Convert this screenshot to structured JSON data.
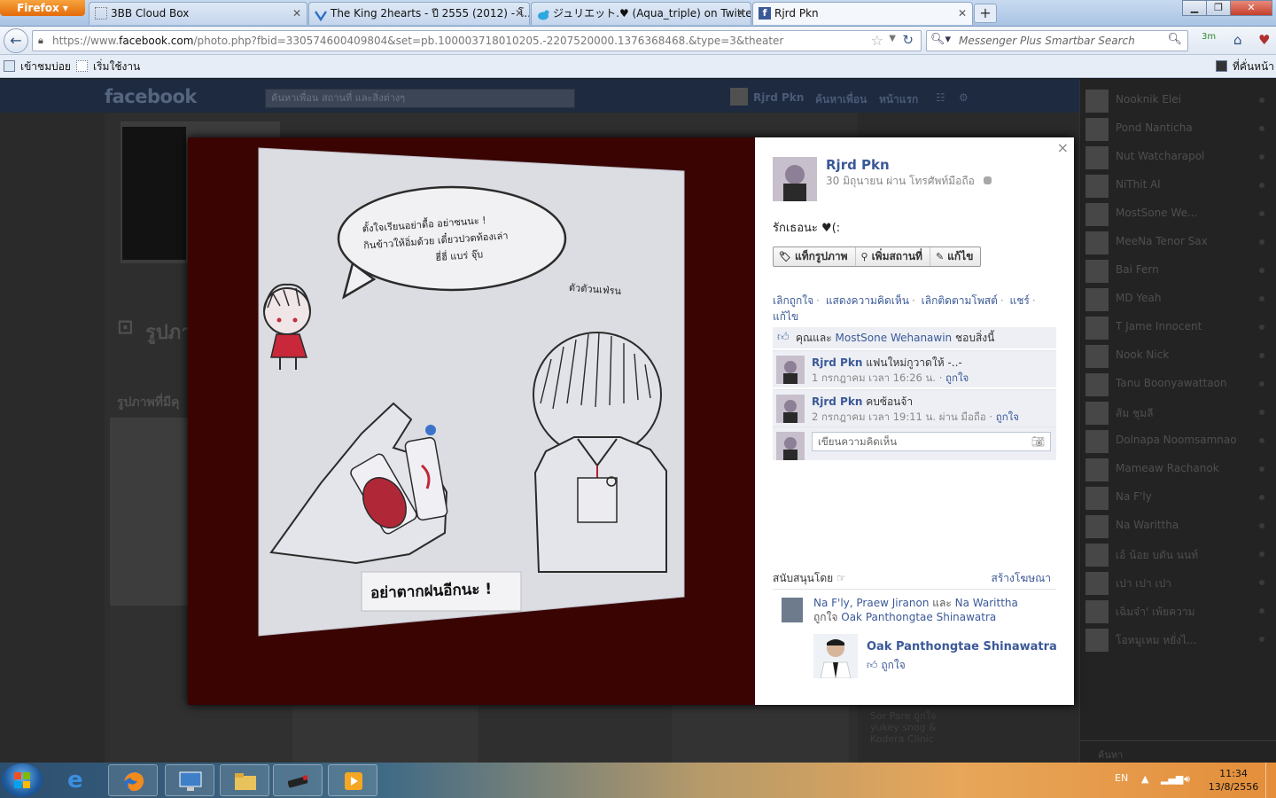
{
  "browser": {
    "app_button": "Firefox",
    "tabs": [
      {
        "title": "3BB Cloud Box",
        "active": false
      },
      {
        "title": "The King 2hearts - ปี 2555 (2012) - โ...",
        "active": false
      },
      {
        "title": "ジュリエット.♥ (Aqua_triple) on Twitter",
        "active": false
      },
      {
        "title": "Rjrd Pkn",
        "active": true
      }
    ],
    "url_prefix": "https://www.",
    "url_domain": "facebook.com",
    "url_rest": "/photo.php?fbid=330574600409804&set=pb.100003718010205.-2207520000.1376368468.&type=3&theater",
    "search_placeholder": "Messenger Plus Smartbar Search",
    "bookmarks": [
      "เข้าชมบ่อย",
      "เริ่มใช้งาน"
    ],
    "bookmarks_right": "ที่คั่นหน้า"
  },
  "facebook_bg": {
    "logo": "facebook",
    "search_placeholder": "ค้นหาเพื่อน สถานที่ และสิ่งต่างๆ",
    "nav": [
      "Rjrd Pkn",
      "ค้นหาเพื่อน",
      "หน้าแรก"
    ],
    "section_title": "รูปภา",
    "section_sub": "รูปภาพที่มีคุ",
    "ads_text": [
      "Sor Pare ถูกใจ",
      "yukey snog &",
      "Kodera Clinic"
    ],
    "chat_search": "ค้นหา",
    "chat_list": [
      "Nooknik Elei",
      "Pond Nanticha",
      "Nut Watcharapol",
      "NiThit Al",
      "MostSone We...",
      "MeeNa Tenor Sax",
      "Bai Fern",
      "MD Yeah",
      "T Jame Innocent",
      "Nook Nick",
      "Tanu Boonyawattaon",
      "ส้ม ชุมลี",
      "Dolnapa Noomsamnao",
      "Mameaw Rachanok",
      "Na F'ly",
      "Na Warittha",
      "เอ้ น้อย บตัน นนท์",
      "เปา เปา เปา",
      "เฉิ่มจ๋า' เพ้ยความ",
      "โอหมูเหม หยั่งไ..."
    ]
  },
  "photo": {
    "bubble_lines": [
      "ตั้งใจเรียนอย่าดื้อ อย่าซนนะ !",
      "กินข้าวให้อิ่มด้วย เดี๋ยวปวดท้องเล่า",
      "ฮี่ฮี่ แบร่ จุ๊บ"
    ],
    "boy_label": "ตัวตัวนเฟ่รน",
    "bottom_note": "อย่าตากฝนอีกนะ !"
  },
  "post": {
    "close": "×",
    "owner": "Rjrd Pkn",
    "meta": "30 มิถุนายน ผ่าน โทรศัพท์มือถือ",
    "caption": "รักเธอนะ ♥(:",
    "buttons": [
      "แท็กรูปภาพ",
      "เพิ่มสถานที่",
      "แก้ไข"
    ],
    "links": [
      "เลิกถูกใจ",
      "แสดงความคิดเห็น",
      "เลิกติดตามโพสต์",
      "แชร์",
      "แก้ไข"
    ],
    "likes_prefix": "คุณและ",
    "likes_name": "MostSone Wehanawin",
    "likes_suffix": "ชอบสิ่งนี้",
    "comments": [
      {
        "author": "Rjrd Pkn",
        "text": "แฟนใหม่กูวาดให้ -..-",
        "time": "1 กรกฎาคม เวลา 16:26 น.",
        "like": "ถูกใจ"
      },
      {
        "author": "Rjrd Pkn",
        "text": "คบซ้อนจ้า",
        "time": "2 กรกฎาคม เวลา 19:11 น. ผ่าน มือถือ",
        "like": "ถูกใจ"
      }
    ],
    "comment_placeholder": "เขียนความคิดเห็น",
    "sponsored_title": "สนับสนุนโดย",
    "create_ad": "สร้างโฆษณา",
    "social_names": "Na F'ly, Praew Jiranon",
    "social_and": "และ",
    "social_name3": "Na Warittha",
    "social_liked": "ถูกใจ",
    "social_page": "Oak Panthongtae Shinawatra",
    "ad_name": "Oak Panthongtae Shinawatra",
    "ad_like": "ถูกใจ"
  },
  "taskbar": {
    "lang": "EN",
    "time": "11:34",
    "date": "13/8/2556"
  },
  "colors": {
    "fb_link": "#3b5998",
    "stage_bg": "#3a0403",
    "firefox_orange": "#e36b0a"
  }
}
